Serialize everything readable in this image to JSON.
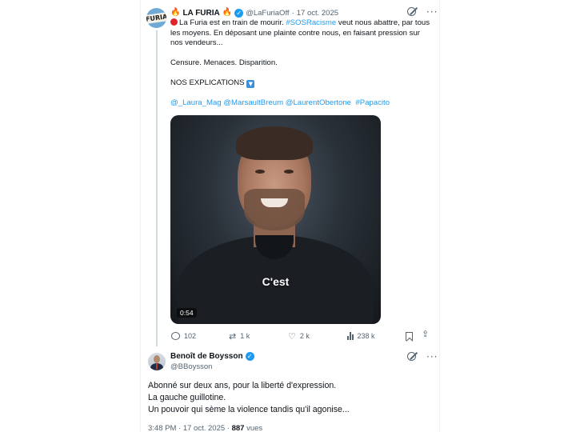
{
  "parent_tweet": {
    "avatar_text": "FURIA",
    "display_name": "LA FURIA",
    "handle": "@LaFuriaOff",
    "separator": "·",
    "date": "17 oct. 2025",
    "body": {
      "line1_pre": "La Furia est en train de mourir. ",
      "line1_hashtag": "#SOSRacisme",
      "line1_post": " veut nous abattre, par tous les moyens. En déposant une plainte contre nous, en faisant pression sur nos vendeurs...",
      "line2": "Censure. Menaces. Disparition.",
      "line3": "NOS EXPLICATIONS",
      "mentions": "@_Laura_Mag @MarsaultBreum @LaurentObertone",
      "hashtag2": "#Papacito"
    },
    "video": {
      "caption": "C'est",
      "duration": "0:54"
    },
    "actions": {
      "replies": "102",
      "reposts": "1 k",
      "likes": "2 k",
      "views": "238 k"
    }
  },
  "reply_tweet": {
    "display_name": "Benoît de Boysson",
    "handle": "@BBoysson",
    "lines": [
      "Abonné sur deux ans, pour la liberté d'expression.",
      "La gauche guillotine.",
      "Un pouvoir qui sème la violence tandis qu'il agonise..."
    ],
    "time": "3:48 PM",
    "date": "17 oct. 2025",
    "views_count": "887",
    "views_label": "vues"
  },
  "colors": {
    "accent": "#1d9bf0",
    "text": "#0f1419",
    "muted": "#536471"
  }
}
